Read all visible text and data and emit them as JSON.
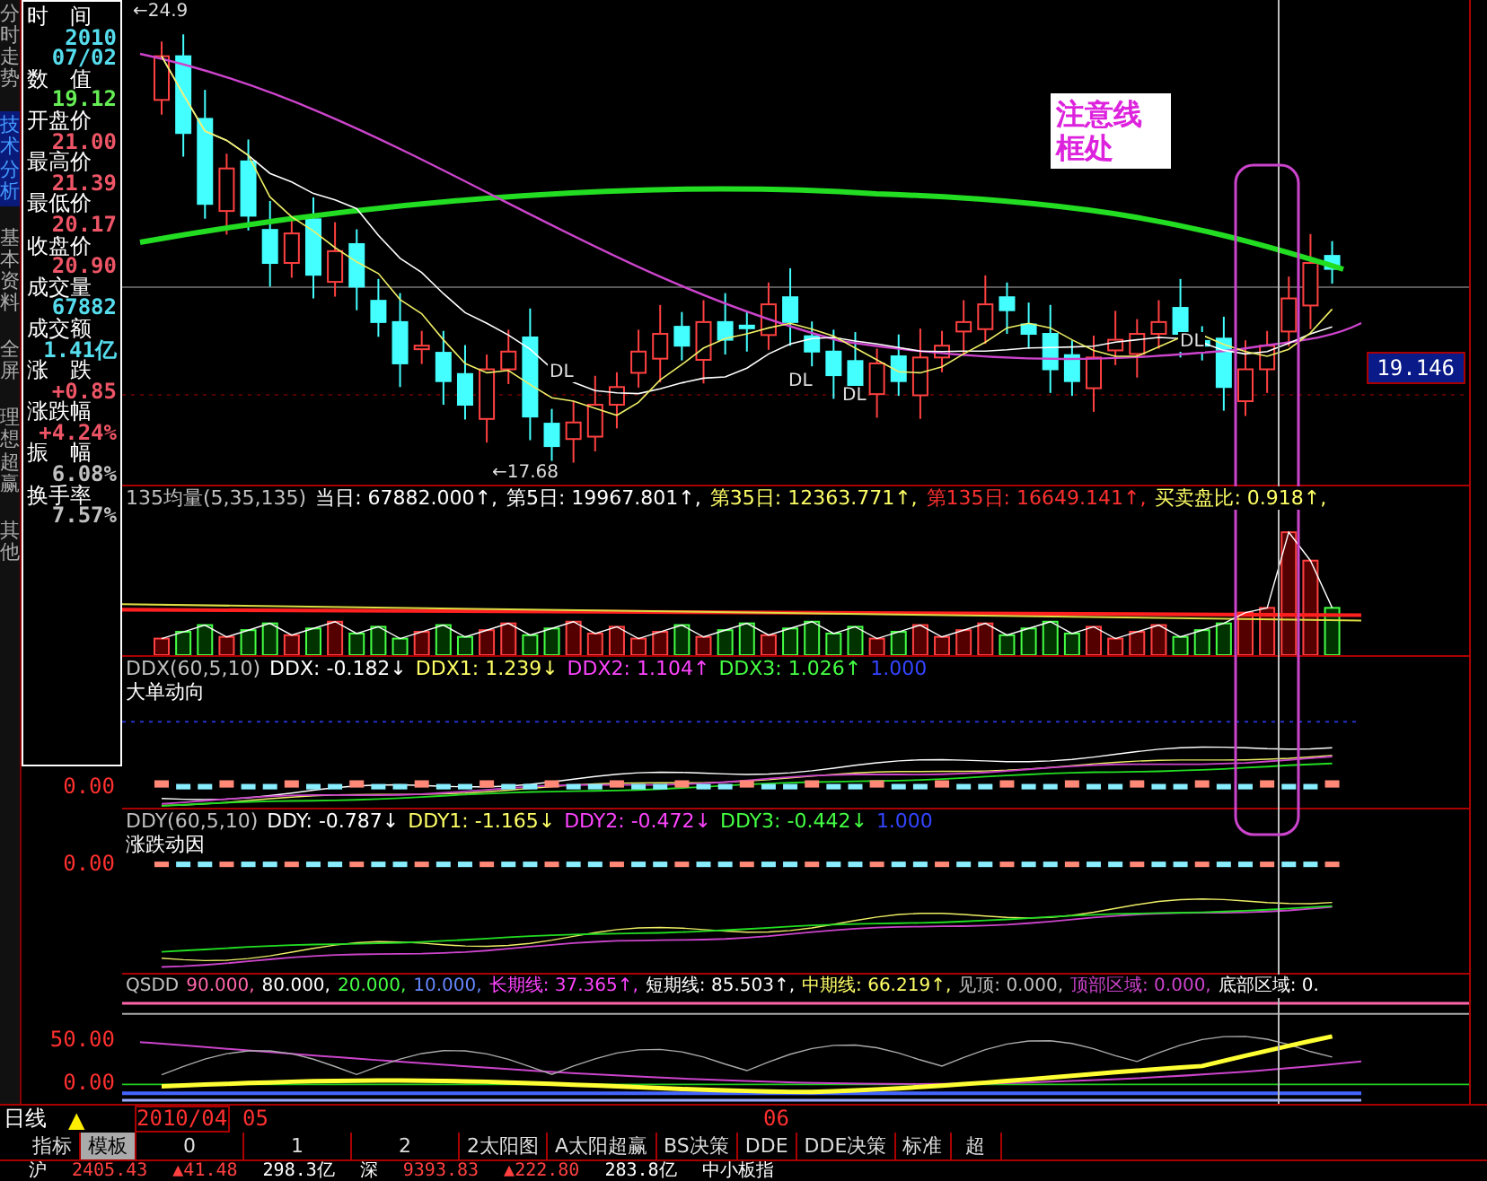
{
  "sidebar_tabs": [
    {
      "label": "分时走势",
      "selected": false
    },
    {
      "label": "技术分析",
      "selected": true
    },
    {
      "label": "基本资料",
      "selected": false
    },
    {
      "label": "全屏",
      "selected": false
    },
    {
      "label": "理想超赢",
      "selected": false
    },
    {
      "label": "其他",
      "selected": false
    }
  ],
  "quote_panel": [
    {
      "label": "时　间",
      "values": [
        "2010",
        "07/02"
      ],
      "color": "#55ddee"
    },
    {
      "label": "数　值",
      "values": [
        "19.12"
      ],
      "color": "#66ee55"
    },
    {
      "label": "开盘价",
      "values": [
        "21.00"
      ],
      "color": "#ee5566"
    },
    {
      "label": "最高价",
      "values": [
        "21.39"
      ],
      "color": "#ee5566"
    },
    {
      "label": "最低价",
      "values": [
        "20.17"
      ],
      "color": "#ee5566"
    },
    {
      "label": "收盘价",
      "values": [
        "20.90"
      ],
      "color": "#ee5566"
    },
    {
      "label": "成交量",
      "values": [
        "67882"
      ],
      "color": "#55ddee"
    },
    {
      "label": "成交额",
      "values": [
        "1.41亿"
      ],
      "color": "#55ddee"
    },
    {
      "label": "涨　跌",
      "values": [
        "+0.85"
      ],
      "color": "#ee5566"
    },
    {
      "label": "涨跌幅",
      "values": [
        "+4.24%"
      ],
      "color": "#ee5566"
    },
    {
      "label": "振　幅",
      "values": [
        "6.08%"
      ],
      "color": "#c0c0c0"
    },
    {
      "label": "换手率",
      "values": [
        "7.57%"
      ],
      "color": "#c0c0c0"
    }
  ],
  "price_panel": {
    "high_marker": "←24.9",
    "low_marker": "←17.68",
    "signal_labels": [
      "DL",
      "DL",
      "DL",
      "DL"
    ],
    "note": "注意线框处",
    "cursor_price": "19.146"
  },
  "volume_panel": {
    "header": [
      {
        "text": "135均量(5,35,135)",
        "color": "#c0c0c0"
      },
      {
        "text": "当日: 67882.000↑,",
        "color": "#ffffff"
      },
      {
        "text": "第5日: 19967.801↑,",
        "color": "#ffffff"
      },
      {
        "text": "第35日: 12363.771↑,",
        "color": "#ffff66"
      },
      {
        "text": "第135日: 16649.141↑,",
        "color": "#ff3030"
      },
      {
        "text": "买卖盘比: 0.918↑,",
        "color": "#ffff66"
      }
    ]
  },
  "ddx_panel": {
    "header": [
      {
        "text": "DDX(60,5,10)",
        "color": "#c0c0c0"
      },
      {
        "text": "DDX: -0.182↓",
        "color": "#ffffff"
      },
      {
        "text": "DDX1: 1.239↓",
        "color": "#ffff66"
      },
      {
        "text": "DDX2: 1.104↑",
        "color": "#ff44ff"
      },
      {
        "text": "DDX3: 1.026↑",
        "color": "#44ff44"
      },
      {
        "text": "1.000",
        "color": "#3344ff"
      }
    ],
    "subtitle": "大单动向",
    "axis_label": "0.00"
  },
  "ddy_panel": {
    "header": [
      {
        "text": "DDY(60,5,10)",
        "color": "#c0c0c0"
      },
      {
        "text": "DDY: -0.787↓",
        "color": "#ffffff"
      },
      {
        "text": "DDY1: -1.165↓",
        "color": "#ffff66"
      },
      {
        "text": "DDY2: -0.472↓",
        "color": "#ff44ff"
      },
      {
        "text": "DDY3: -0.442↓",
        "color": "#44ff44"
      },
      {
        "text": "1.000",
        "color": "#3344ff"
      }
    ],
    "subtitle": "涨跌动因",
    "axis_label": "0.00"
  },
  "qsdd_panel": {
    "header": [
      {
        "text": "QSDD",
        "color": "#c0c0c0"
      },
      {
        "text": "90.000,",
        "color": "#ff66aa"
      },
      {
        "text": "80.000,",
        "color": "#ffffff"
      },
      {
        "text": "20.000,",
        "color": "#44ff44"
      },
      {
        "text": "10.000,",
        "color": "#6688ff"
      },
      {
        "text": "长期线: 37.365↑,",
        "color": "#ff44ff"
      },
      {
        "text": "短期线: 85.503↑,",
        "color": "#ffffff"
      },
      {
        "text": "中期线: 66.219↑,",
        "color": "#ffff66"
      },
      {
        "text": "见顶: 0.000,",
        "color": "#c0c0c0"
      },
      {
        "text": "顶部区域: 0.000,",
        "color": "#cc44cc"
      },
      {
        "text": "底部区域: 0.",
        "color": "#ffffff"
      }
    ],
    "axis_labels": [
      "50.00",
      "0.00"
    ]
  },
  "date_axis": {
    "period": "日线",
    "period_icon": "▲",
    "labels": [
      "2010/04",
      "05",
      "06"
    ]
  },
  "bottom_tabs": [
    {
      "label": "指标",
      "selected": false
    },
    {
      "label": "模板",
      "selected": true
    },
    {
      "label": "0",
      "selected": false
    },
    {
      "label": "1",
      "selected": false
    },
    {
      "label": "2",
      "selected": false
    },
    {
      "label": "2太阳图",
      "selected": false
    },
    {
      "label": "A太阳超赢",
      "selected": false
    },
    {
      "label": "BS决策",
      "selected": false
    },
    {
      "label": "DDE",
      "selected": false
    },
    {
      "label": "DDE决策",
      "selected": false
    },
    {
      "label": "标准",
      "selected": false
    },
    {
      "label": "超",
      "selected": false
    }
  ],
  "status_bar": [
    {
      "text": "沪",
      "color": "#ffffff"
    },
    {
      "text": "2405.43",
      "color": "#ff4040"
    },
    {
      "text": "▲41.48",
      "color": "#ff4040"
    },
    {
      "text": "298.3亿",
      "color": "#ffffff"
    },
    {
      "text": "深",
      "color": "#ffffff"
    },
    {
      "text": "9393.83",
      "color": "#ff4040"
    },
    {
      "text": "▲222.80",
      "color": "#ff4040"
    },
    {
      "text": "283.8亿",
      "color": "#ffffff"
    },
    {
      "text": "中小板指",
      "color": "#ffffff"
    }
  ]
}
